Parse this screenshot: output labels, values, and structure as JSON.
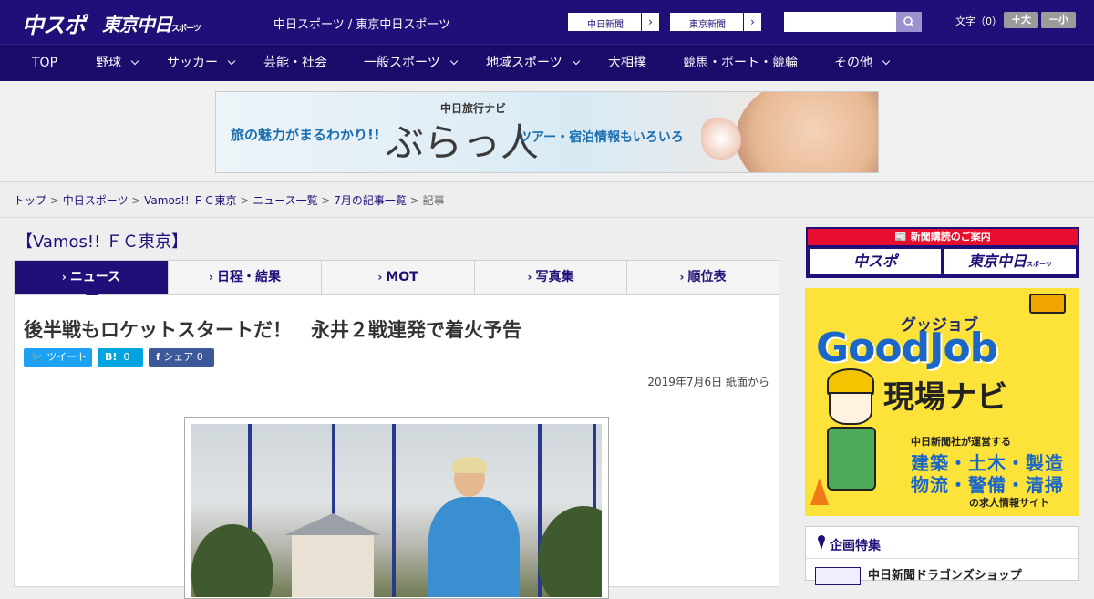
{
  "header": {
    "logo_primary": "中スポ",
    "logo_secondary": "東京中日",
    "logo_secondary_small": "スポーツ",
    "site_title": "中日スポーツ / 東京中日スポーツ",
    "paper_links": [
      "中日新聞",
      "東京新聞"
    ],
    "search": {
      "placeholder": ""
    },
    "font_size_label": "文字（0）",
    "font_larger": "＋大",
    "font_smaller": "－小",
    "colors": {
      "brand": "#1f0f78",
      "accent": "#e60d2e"
    }
  },
  "nav": {
    "items": [
      {
        "label": "TOP"
      },
      {
        "label": "野球"
      },
      {
        "label": "サッカー"
      },
      {
        "label": "芸能・社会"
      },
      {
        "label": "一般スポーツ"
      },
      {
        "label": "地域スポーツ"
      },
      {
        "label": "大相撲"
      },
      {
        "label": "競馬・ボート・競輪"
      },
      {
        "label": "その他"
      }
    ]
  },
  "banner": {
    "text_left": "旅の魅力がまるわかり!!",
    "brand_small": "中日旅行ナビ",
    "brand_large": "ぶらっ人",
    "text_right": "ツアー・宿泊情報もいろいろ"
  },
  "breadcrumb": {
    "items": [
      "トップ",
      "中日スポーツ",
      "Vamos!! ＦＣ東京",
      "ニュース一覧",
      "7月の記事一覧",
      "記事"
    ]
  },
  "section": {
    "title": "【Vamos!! ＦＣ東京】"
  },
  "tabs": [
    {
      "label": "ニュース",
      "active": true
    },
    {
      "label": "日程・結果"
    },
    {
      "label": "MOT"
    },
    {
      "label": "写真集"
    },
    {
      "label": "順位表"
    }
  ],
  "article": {
    "headline": "後半戦もロケットスタートだ！　永井２戦連発で着火予告",
    "share": {
      "tweet": "ツイート",
      "hatena": "B!",
      "hatena_count": "0",
      "facebook": "シェア",
      "facebook_count": "0"
    },
    "date": "2019年7月6日 紙面から"
  },
  "sidebar": {
    "subscribe_header": "新聞購読のご案内",
    "subscribe_buttons": [
      "中スポ",
      "東京中日"
    ],
    "subscribe_small": "スポーツ",
    "job_ad": {
      "kana": "グッジョブ",
      "title": "GoodJob",
      "subtitle": "現場ナビ",
      "line1": "中日新聞社が運営する",
      "line2": "建築・土木・製造",
      "line3": "物流・警備・清掃",
      "line4": "の求人情報サイト"
    },
    "feature_title": "企画特集",
    "feature_item": "中日新聞ドラゴンズショップ"
  }
}
